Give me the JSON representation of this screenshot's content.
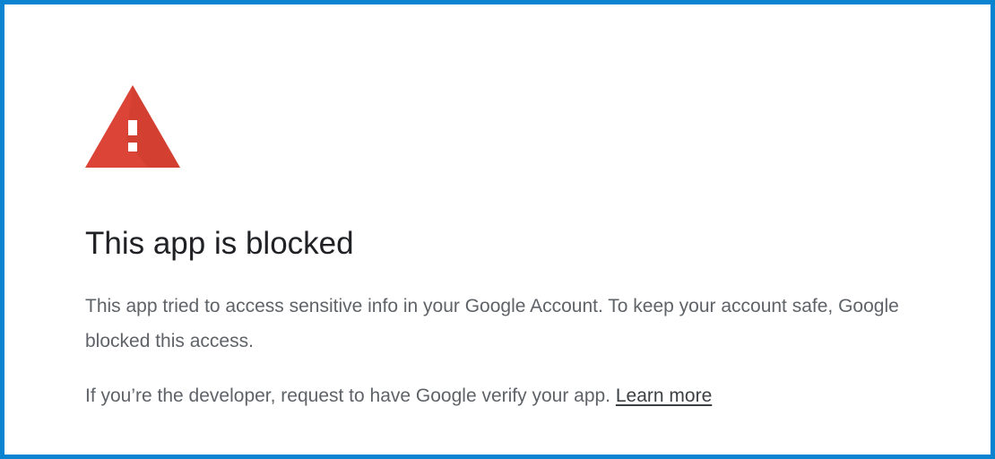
{
  "dialog": {
    "icon": "warning-triangle-icon",
    "icon_color": "#db4437",
    "title": "This app is blocked",
    "message": "This app tried to access sensitive info in your Google Account. To keep your account safe, Google blocked this access.",
    "developer_note": "If you’re the developer, request to have Google verify your app.",
    "learn_more_label": "Learn more",
    "border_color": "#0a84d0"
  }
}
